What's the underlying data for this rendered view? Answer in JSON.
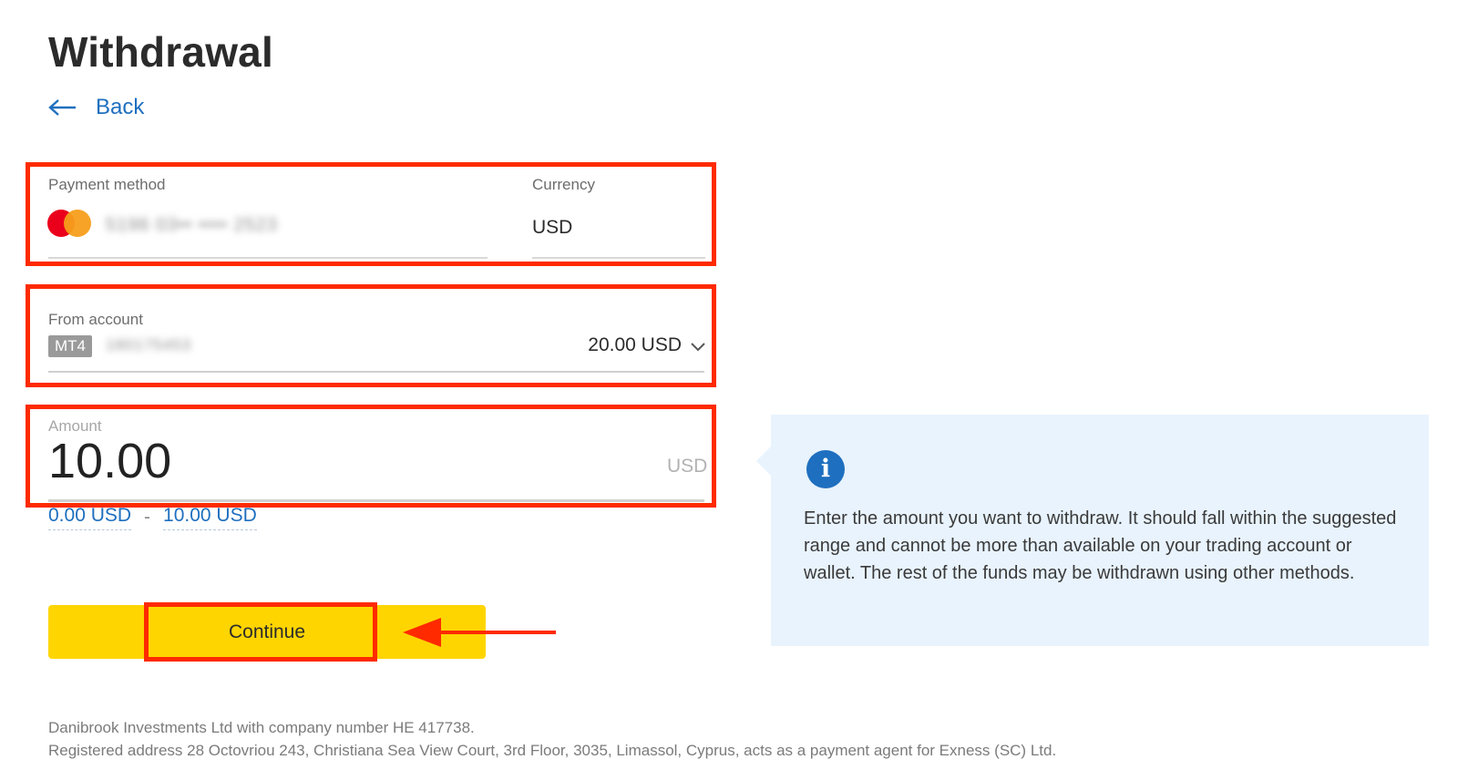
{
  "page": {
    "title": "Withdrawal"
  },
  "nav": {
    "back_label": "Back"
  },
  "payment": {
    "method_label": "Payment method",
    "method_value": "5196 03•• •••• 2523",
    "currency_label": "Currency",
    "currency_value": "USD"
  },
  "from_account": {
    "label": "From account",
    "platform_badge": "MT4",
    "account_number": "180175453",
    "balance": "20.00 USD"
  },
  "amount": {
    "label": "Amount",
    "value": "10.00",
    "unit": "USD",
    "min": "0.00 USD",
    "separator": "-",
    "max": "10.00 USD"
  },
  "actions": {
    "continue_label": "Continue"
  },
  "info": {
    "text": "Enter the amount you want to withdraw. It should fall within the suggested range and cannot be more than available on your trading account or wallet. The rest of the funds may be withdrawn using other methods."
  },
  "footer": {
    "line1": "Danibrook Investments Ltd with company number HE 417738.",
    "line2": "Registered address 28 Octovriou 243, Christiana Sea View Court, 3rd Floor, 3035, Limassol, Cyprus, acts as a payment agent for Exness (SC) Ltd."
  },
  "colors": {
    "accent_blue": "#1e6fbf",
    "button_yellow": "#ffd500",
    "annotation_red": "#ff2a00",
    "info_bg": "#e8f3fd"
  }
}
